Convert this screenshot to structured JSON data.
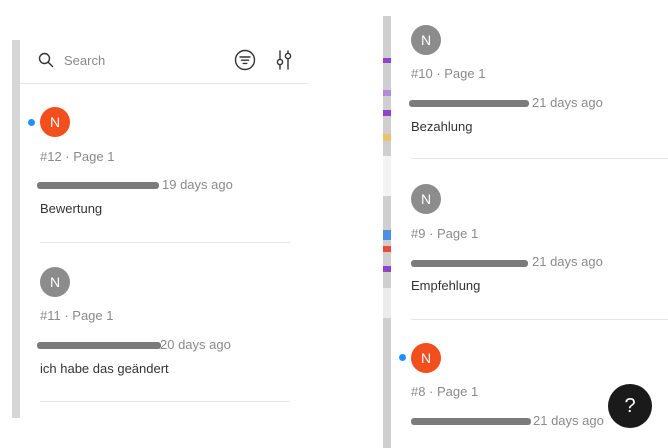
{
  "search": {
    "placeholder": "Search"
  },
  "icons": {
    "search": "search-icon",
    "filter": "filter-icon",
    "sliders": "sliders-icon",
    "help": "question-mark-icon"
  },
  "colors": {
    "avatar_orange": "#f24e1e",
    "avatar_gray": "#8c8c8c",
    "unread_dot": "#1e90ff",
    "help_button": "#1a1a1a"
  },
  "left_comments": [
    {
      "avatar": "N",
      "meta": "#12 · Page 1",
      "time": "19 days ago",
      "text": "Bewertung",
      "unread": true
    },
    {
      "avatar": "N",
      "meta": "#11 · Page 1",
      "time": "20 days ago",
      "text": "ich habe das geändert",
      "unread": false
    }
  ],
  "right_comments": [
    {
      "avatar": "N",
      "meta": "#10 · Page 1",
      "time": "21 days ago",
      "text": "Bezahlung",
      "unread": false
    },
    {
      "avatar": "N",
      "meta": "#9 · Page 1",
      "time": "21 days ago",
      "text": "Empfehlung",
      "unread": false
    },
    {
      "avatar": "N",
      "meta": "#8 · Page 1",
      "time": "21 days ago",
      "text": "",
      "unread": true
    }
  ],
  "help": {
    "label": "?"
  }
}
